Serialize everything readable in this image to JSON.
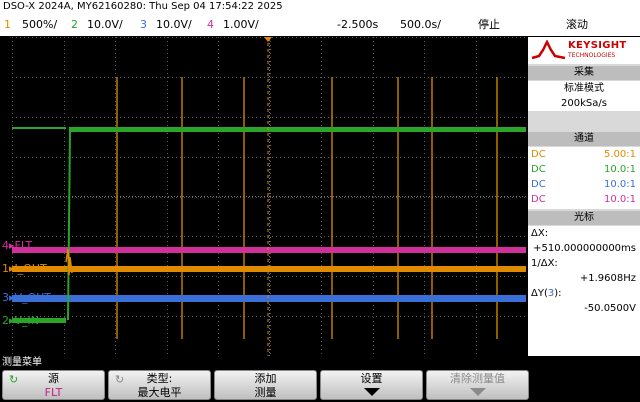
{
  "title": "DSO-X 2024A, MY62160280: Thu Sep 04 17:54:22 2025",
  "channels": [
    {
      "num": "1",
      "scale": "500%/",
      "color": "#e08a00"
    },
    {
      "num": "2",
      "scale": "10.0V/",
      "color": "#2aa52a"
    },
    {
      "num": "3",
      "scale": "10.0V/",
      "color": "#3a6fd8"
    },
    {
      "num": "4",
      "scale": "1.00V/",
      "color": "#d0309a"
    }
  ],
  "timebase": {
    "delay": "-2.500s",
    "scale": "500.0s/"
  },
  "run_state": "停止",
  "trigger_mode": "滚动",
  "brand": {
    "name": "KEYSIGHT",
    "sub": "TECHNOLOGIES"
  },
  "sidebar": {
    "acquire_header": "采集",
    "acquire_mode": "标准模式",
    "sample_rate": "200kSa/s",
    "channels_header": "通道",
    "probe_rows": [
      {
        "coupling": "DC",
        "ratio": "5.00:1",
        "color": "#e08a00"
      },
      {
        "coupling": "DC",
        "ratio": "10.0:1",
        "color": "#2aa52a"
      },
      {
        "coupling": "DC",
        "ratio": "10.0:1",
        "color": "#3a6fd8"
      },
      {
        "coupling": "DC",
        "ratio": "10.0:1",
        "color": "#d0309a"
      }
    ],
    "cursor_header": "光标",
    "dx_label": "ΔX:",
    "dx_value": "+510.000000000ms",
    "inv_dx_label": "1/ΔX:",
    "inv_dx_value": "+1.9608Hz",
    "dy_label_pre": "ΔY(",
    "dy_channel": "3",
    "dy_label_post": "):",
    "dy_value": "-50.0500V"
  },
  "trace_labels": [
    {
      "num": "4",
      "name": "FLT",
      "color": "#d0309a"
    },
    {
      "num": "1",
      "name": "I_OUT",
      "color": "#e08a00"
    },
    {
      "num": "3",
      "name": "V_OUT",
      "color": "#3a6fd8"
    },
    {
      "num": "2",
      "name": "V_IN",
      "color": "#2aa52a"
    }
  ],
  "menu": {
    "title": "测量菜单",
    "softkeys": [
      {
        "label": "源",
        "value": "FLT",
        "value_color": "#c0208a"
      },
      {
        "label": "类型:",
        "value": "最大电平"
      },
      {
        "label": "添加",
        "value": "测量"
      },
      {
        "label": "设置",
        "value": ""
      },
      {
        "label": "清除测量值",
        "value": ""
      }
    ]
  }
}
